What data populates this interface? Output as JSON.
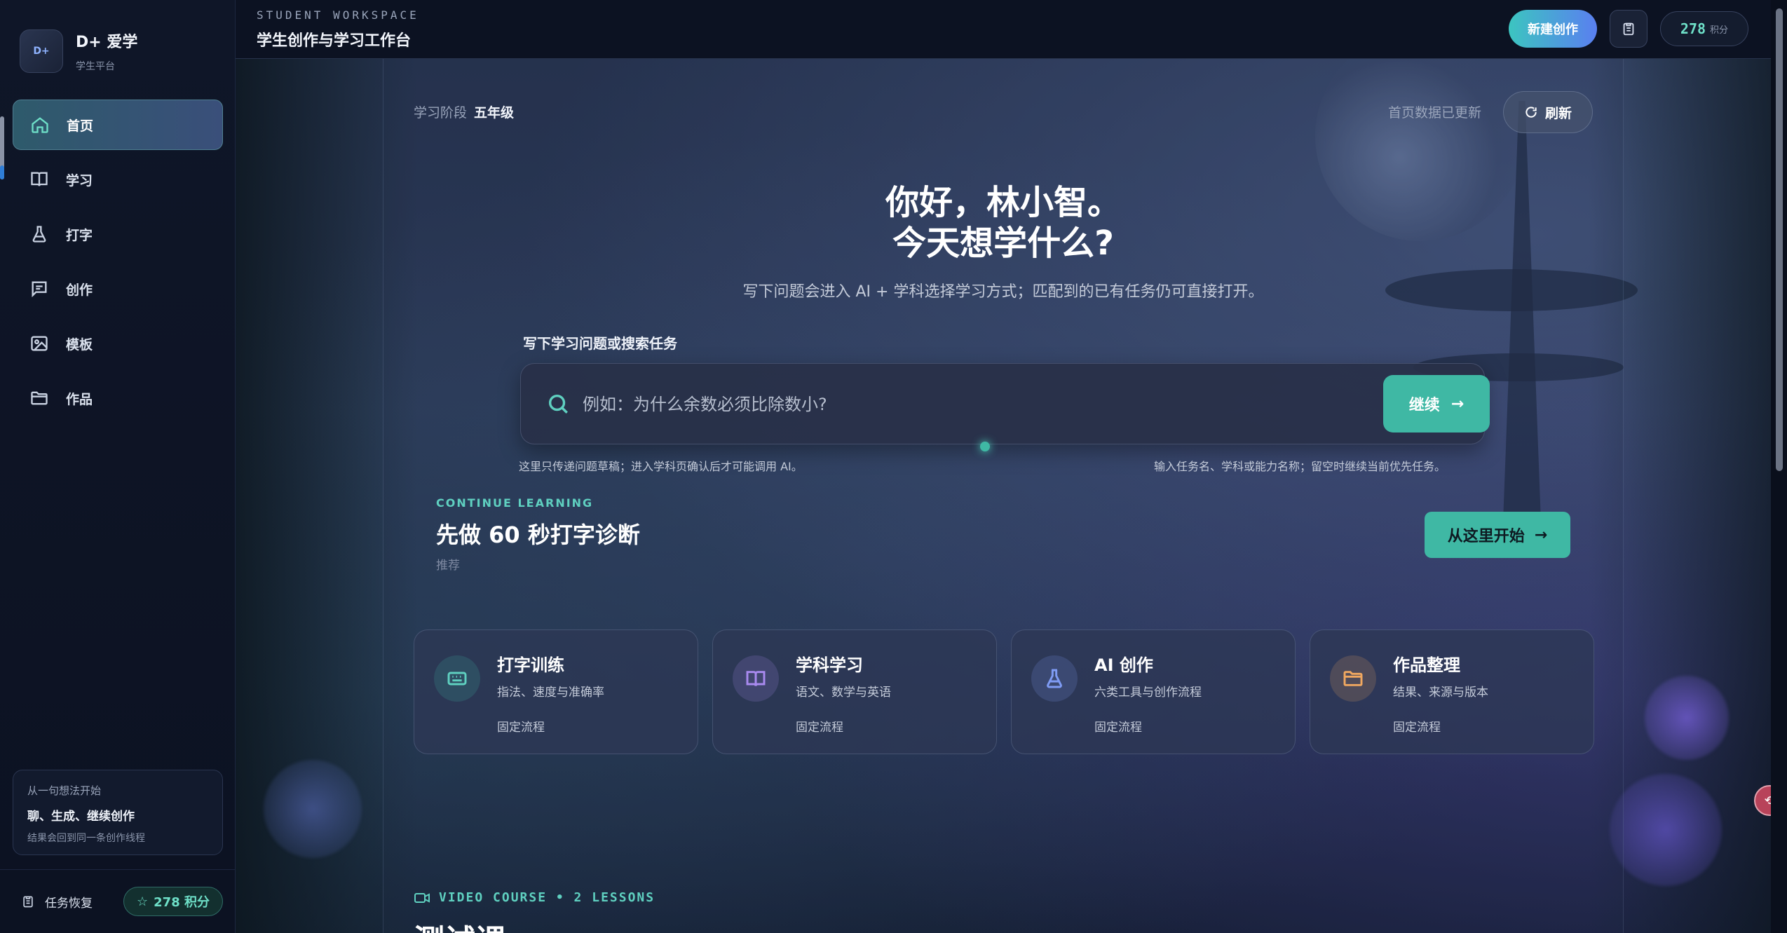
{
  "brand": {
    "logo_text": "D+",
    "name": "D+ 爱学",
    "subtitle": "学生平台"
  },
  "nav": {
    "items": [
      {
        "label": "首页",
        "icon": "home-icon",
        "active": true
      },
      {
        "label": "学习",
        "icon": "book-icon",
        "active": false
      },
      {
        "label": "打字",
        "icon": "flask-icon",
        "active": false
      },
      {
        "label": "创作",
        "icon": "message-icon",
        "active": false
      },
      {
        "label": "模板",
        "icon": "image-icon",
        "active": false
      },
      {
        "label": "作品",
        "icon": "folder-icon",
        "active": false
      }
    ]
  },
  "idea_card": {
    "eyebrow": "从一句想法开始",
    "title": "聊、生成、继续创作",
    "desc": "结果会回到同一条创作线程"
  },
  "sidebar_footer": {
    "task_restore": "任务恢复",
    "points_label": "278 积分"
  },
  "topbar": {
    "eyebrow": "STUDENT WORKSPACE",
    "title": "学生创作与学习工作台",
    "new_button": "新建创作",
    "points_value": "278",
    "points_unit": "积分"
  },
  "main": {
    "stage_label": "学习阶段",
    "stage_value": "五年级",
    "updated_text": "首页数据已更新",
    "refresh_button": "刷新",
    "greeting_line1": "你好，林小智。",
    "greeting_line2": "今天想学什么?",
    "subtitle": "写下问题会进入 AI + 学科选择学习方式；匹配到的已有任务仍可直接打开。",
    "search": {
      "label": "写下学习问题或搜索任务",
      "placeholder": "例如：为什么余数必须比除数小?",
      "value": "",
      "button": "继续"
    },
    "hint_left": "这里只传递问题草稿；进入学科页确认后才可能调用 AI。",
    "hint_right": "输入任务名、学科或能力名称；留空时继续当前优先任务。",
    "continue": {
      "eyebrow": "CONTINUE LEARNING",
      "title": "先做 60 秒打字诊断",
      "tag": "推荐",
      "button": "从这里开始"
    },
    "cards": [
      {
        "title": "打字训练",
        "subtitle": "指法、速度与准确率",
        "footer": "固定流程",
        "icon": "keyboard-icon",
        "color": "#5fd0c0"
      },
      {
        "title": "学科学习",
        "subtitle": "语文、数学与英语",
        "footer": "固定流程",
        "icon": "book-open-icon",
        "color": "#a98af0"
      },
      {
        "title": "AI 创作",
        "subtitle": "六类工具与创作流程",
        "footer": "固定流程",
        "icon": "flask-icon",
        "color": "#7f9cf5"
      },
      {
        "title": "作品整理",
        "subtitle": "结果、来源与版本",
        "footer": "固定流程",
        "icon": "folder-icon",
        "color": "#f0a860"
      }
    ],
    "video_course": {
      "eyebrow": "VIDEO COURSE  •  2 LESSONS",
      "title": "测试课"
    }
  },
  "colors": {
    "accent": "#3fb8a4",
    "accent_text": "#5fd0c0",
    "nav_active": "#2e5a6b",
    "bg": "#0b1120"
  }
}
